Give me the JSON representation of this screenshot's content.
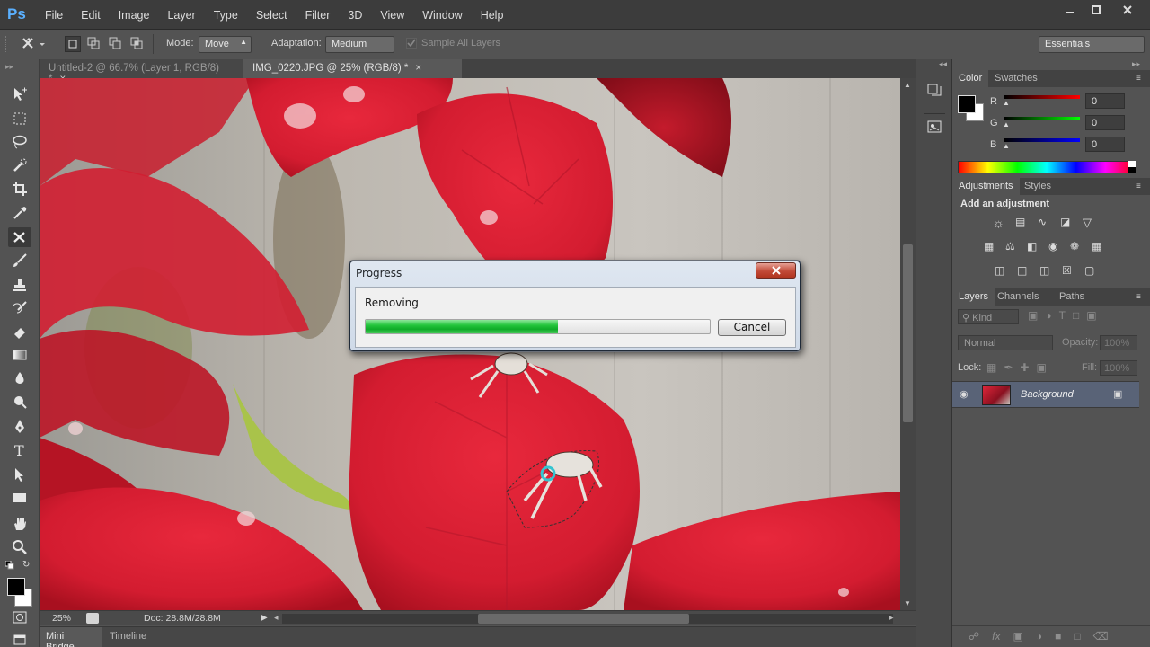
{
  "app": {
    "logo": "Ps"
  },
  "menu": [
    "File",
    "Edit",
    "Image",
    "Layer",
    "Type",
    "Select",
    "Filter",
    "3D",
    "View",
    "Window",
    "Help"
  ],
  "options": {
    "mode_label": "Mode:",
    "mode_value": "Move",
    "adaptation_label": "Adaptation:",
    "adaptation_value": "Medium",
    "sample_all_layers": "Sample All Layers",
    "workspace": "Essentials"
  },
  "tabs": [
    {
      "title": "Untitled-2 @ 66.7% (Layer 1, RGB/8) *",
      "active": false
    },
    {
      "title": "IMG_0220.JPG @ 25% (RGB/8) *",
      "active": true
    }
  ],
  "status": {
    "zoom": "25%",
    "doc": "Doc: 28.8M/28.8M"
  },
  "bottom_tabs": [
    "Mini Bridge",
    "Timeline"
  ],
  "color_panel": {
    "tabs": [
      "Color",
      "Swatches"
    ],
    "r_label": "R",
    "g_label": "G",
    "b_label": "B",
    "r": "0",
    "g": "0",
    "b": "0"
  },
  "adjustments_panel": {
    "tabs": [
      "Adjustments",
      "Styles"
    ],
    "heading": "Add an adjustment"
  },
  "layers_panel": {
    "tabs": [
      "Layers",
      "Channels",
      "Paths"
    ],
    "kind": "Kind",
    "blend_mode": "Normal",
    "opacity_label": "Opacity:",
    "opacity": "100%",
    "lock_label": "Lock:",
    "fill_label": "Fill:",
    "fill": "100%",
    "layer_name": "Background"
  },
  "dialog": {
    "title": "Progress",
    "message": "Removing",
    "progress": 0.56,
    "cancel": "Cancel"
  },
  "colors": {
    "progress_green": "#16b22e",
    "canvas_red": "#d81f32"
  }
}
